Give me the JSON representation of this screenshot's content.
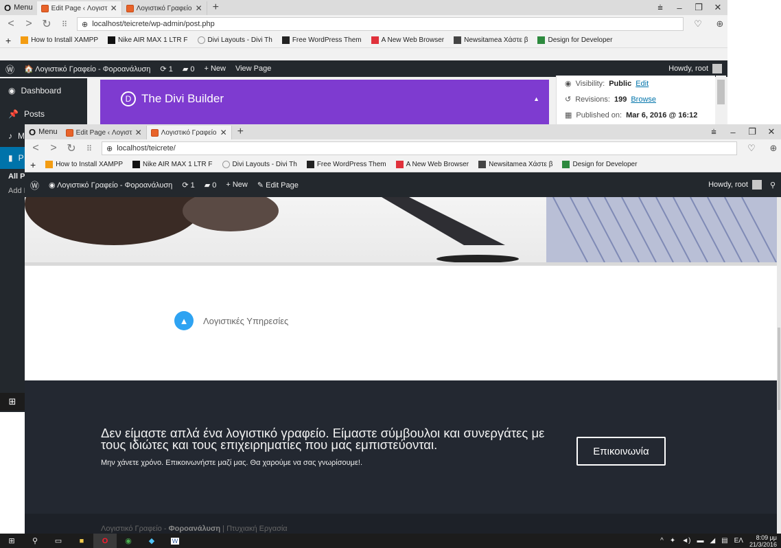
{
  "back_window": {
    "menu_label": "Menu",
    "tabs": [
      {
        "title": "Edit Page ‹ Λογιστικό Γραφ…",
        "active": true
      },
      {
        "title": "Λογιστικό Γραφείο – Φορ…",
        "active": false
      }
    ],
    "url": "localhost/teicrete/wp-admin/post.php",
    "bookmarks": [
      "How to Install XAMPP",
      "Nike AIR MAX 1 LTR F",
      "Divi Layouts - Divi Th",
      "Free WordPress Them",
      "A New Web Browser",
      "Newsitamea Χάστε β",
      "Design for Developer"
    ],
    "adminbar": {
      "site_name": "Λογιστικό Γραφείο - Φοροανάλυση",
      "updates": "1",
      "comments": "0",
      "new_label": "New",
      "view_label": "View Page",
      "howdy": "Howdy, root"
    },
    "sidebar": [
      {
        "label": "Dashboard",
        "icon": "dashboard-icon"
      },
      {
        "label": "Posts",
        "icon": "pin-icon"
      },
      {
        "label": "M",
        "icon": "media-icon"
      },
      {
        "label": "P",
        "icon": "pages-icon"
      }
    ],
    "sidebar_sub": [
      "All Pa",
      "Add N"
    ],
    "divi_title": "The Divi Builder",
    "publish": {
      "visibility_label": "Visibility:",
      "visibility_value": "Public",
      "visibility_link": "Edit",
      "revisions_label": "Revisions:",
      "revisions_value": "199",
      "revisions_link": "Browse",
      "published_label": "Published on:",
      "published_value": "Mar 6, 2016 @ 16:12"
    }
  },
  "front_window": {
    "menu_label": "Menu",
    "tabs": [
      {
        "title": "Edit Page ‹ Λογιστικό Γραφ…",
        "active": false
      },
      {
        "title": "Λογιστικό Γραφείο – Φορ…",
        "active": true
      }
    ],
    "url": "localhost/teicrete/",
    "bookmarks": [
      "How to Install XAMPP",
      "Nike AIR MAX 1 LTR F",
      "Divi Layouts - Divi Th",
      "Free WordPress Them",
      "A New Web Browser",
      "Newsitamea Χάστε β",
      "Design for Developer"
    ],
    "adminbar": {
      "site_name": "Λογιστικό Γραφείο - Φοροανάλυση",
      "updates": "1",
      "comments": "0",
      "new_label": "New",
      "edit_label": "Edit Page",
      "howdy": "Howdy, root"
    },
    "service_label": "Λογιστικές Υπηρεσίες",
    "cta_heading": "Δεν είμαστε απλά ένα λογιστικό γραφείο. Είμαστε σύμβουλοι και συνεργάτες με τους ιδιώτες και τους επιχειρηματίες που μας εμπιστεύονται.",
    "cta_sub": "Μην χάνετε χρόνο. Επικοινωνήστε μαζί μας. Θα χαρούμε να σας γνωρίσουμε!.",
    "cta_button": "Επικοινωνία",
    "footer_prefix": "Λογιστικό Γραφείο - ",
    "footer_bold": "Φοροανάλυση",
    "footer_suffix": " | Πτυχιακή Εργασία"
  },
  "taskbar": {
    "lang": "ΕΛ",
    "time": "8:09 μμ",
    "date": "21/3/2016"
  },
  "colors": {
    "wp_admin_bar": "#23282d",
    "divi_purple": "#7e3bd0",
    "cta_background": "#232831",
    "service_icon": "#2ea3f2"
  }
}
